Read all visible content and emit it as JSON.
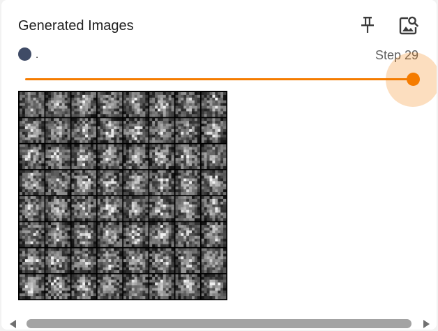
{
  "card": {
    "title": "Generated Images",
    "pin_icon": "pin-icon",
    "expand_icon": "image-search-icon"
  },
  "run": {
    "label": ".",
    "color": "#3f4b66"
  },
  "step": {
    "label": "Step 29",
    "slider_fraction": 1.0,
    "accent_color": "#f57c00"
  },
  "image": {
    "grid_rows": 8,
    "grid_cols": 8
  },
  "scrollbar": {
    "left_arrow_icon": "triangle-left-icon",
    "right_arrow_icon": "triangle-right-icon"
  }
}
